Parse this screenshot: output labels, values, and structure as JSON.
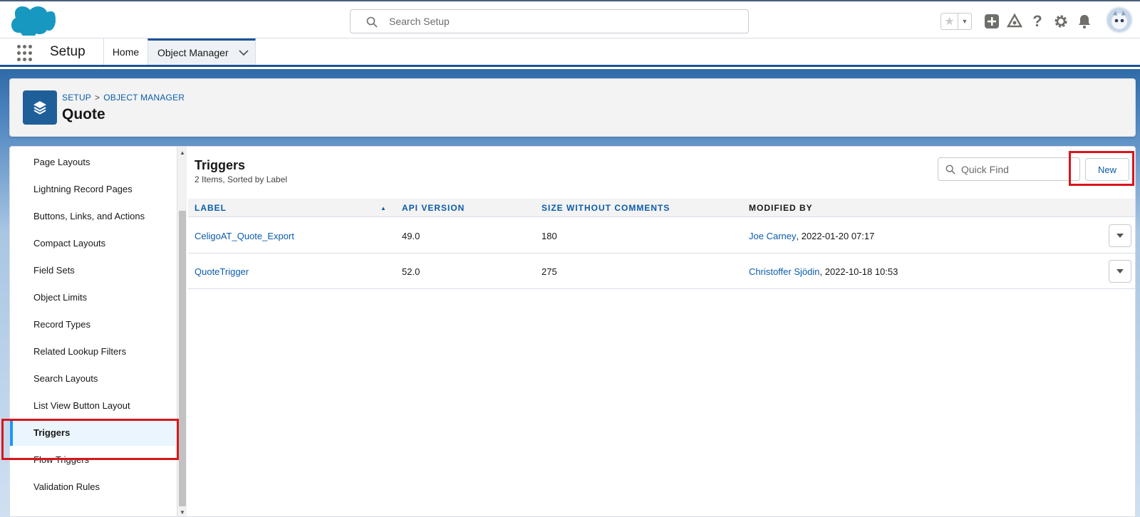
{
  "header": {
    "search_placeholder": "Search Setup"
  },
  "nav": {
    "app_name": "Setup",
    "tabs": [
      {
        "label": "Home"
      },
      {
        "label": "Object Manager"
      }
    ]
  },
  "page_header": {
    "breadcrumb": [
      "SETUP",
      "OBJECT MANAGER"
    ],
    "breadcrumb_separator": ">",
    "title": "Quote"
  },
  "sidebar": {
    "items": [
      {
        "label": "Page Layouts"
      },
      {
        "label": "Lightning Record Pages"
      },
      {
        "label": "Buttons, Links, and Actions"
      },
      {
        "label": "Compact Layouts"
      },
      {
        "label": "Field Sets"
      },
      {
        "label": "Object Limits"
      },
      {
        "label": "Record Types"
      },
      {
        "label": "Related Lookup Filters"
      },
      {
        "label": "Search Layouts"
      },
      {
        "label": "List View Button Layout"
      },
      {
        "label": "Triggers",
        "active": true
      },
      {
        "label": "Flow Triggers"
      },
      {
        "label": "Validation Rules"
      }
    ]
  },
  "content": {
    "title": "Triggers",
    "subtitle": "2 Items, Sorted by Label",
    "quick_find_placeholder": "Quick Find",
    "new_button": "New",
    "columns": [
      "LABEL",
      "API VERSION",
      "SIZE WITHOUT COMMENTS",
      "MODIFIED BY"
    ],
    "rows": [
      {
        "label": "CeligoAT_Quote_Export",
        "api_version": "49.0",
        "size": "180",
        "modified_by_name": "Joe Carney",
        "modified_at": ", 2022-01-20 07:17"
      },
      {
        "label": "QuoteTrigger",
        "api_version": "52.0",
        "size": "275",
        "modified_by_name": "Christoffer Sjödin",
        "modified_at": ", 2022-10-18 10:53"
      }
    ]
  },
  "colors": {
    "brand_blue": "#0b5cab",
    "highlight_red": "#d9151c",
    "active_bar": "#1b96ff"
  }
}
